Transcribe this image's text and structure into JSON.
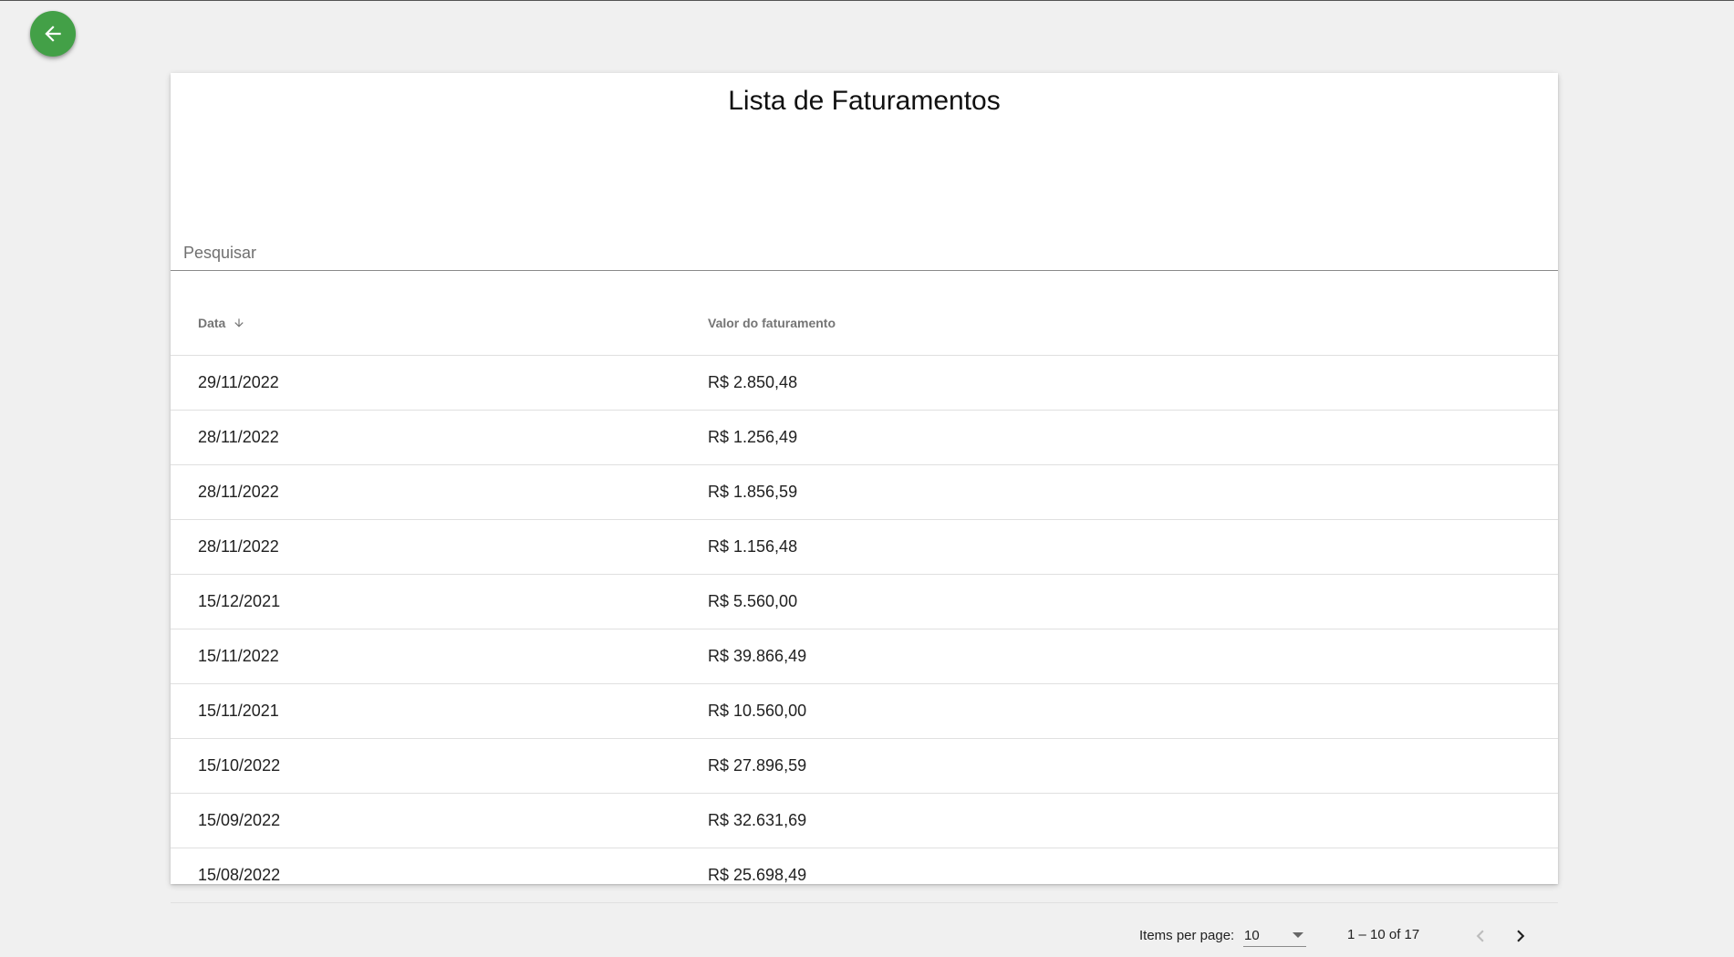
{
  "title": "Lista de Faturamentos",
  "search": {
    "placeholder": "Pesquisar",
    "value": ""
  },
  "table": {
    "columns": [
      "Data",
      "Valor do faturamento"
    ],
    "sort": {
      "column": "Data",
      "direction": "desc"
    },
    "rows": [
      {
        "date": "29/11/2022",
        "value": "R$ 2.850,48"
      },
      {
        "date": "28/11/2022",
        "value": "R$ 1.256,49"
      },
      {
        "date": "28/11/2022",
        "value": "R$ 1.856,59"
      },
      {
        "date": "28/11/2022",
        "value": "R$ 1.156,48"
      },
      {
        "date": "15/12/2021",
        "value": "R$ 5.560,00"
      },
      {
        "date": "15/11/2022",
        "value": "R$ 39.866,49"
      },
      {
        "date": "15/11/2021",
        "value": "R$ 10.560,00"
      },
      {
        "date": "15/10/2022",
        "value": "R$ 27.896,59"
      },
      {
        "date": "15/09/2022",
        "value": "R$ 32.631,69"
      },
      {
        "date": "15/08/2022",
        "value": "R$ 25.698,49"
      }
    ]
  },
  "paginator": {
    "items_per_page_label": "Items per page:",
    "items_per_page": "10",
    "range_label": "1 – 10 of 17"
  },
  "colors": {
    "accent": "#43a047",
    "background": "#f0f0f0"
  },
  "icons": {
    "back": "arrow-left-icon",
    "sort": "arrow-down-icon",
    "prev": "chevron-left-icon",
    "next": "chevron-right-icon"
  }
}
